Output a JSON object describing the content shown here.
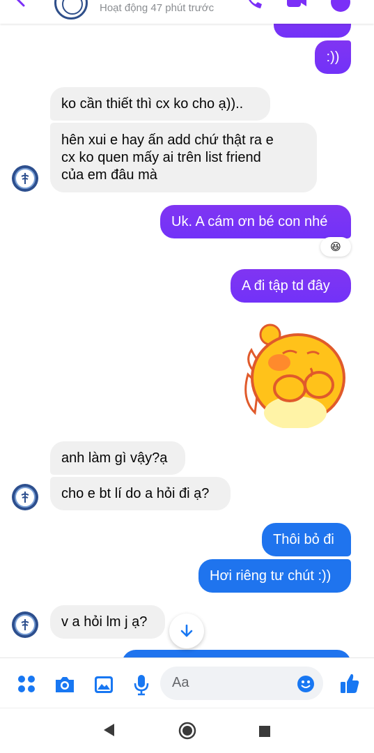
{
  "header": {
    "status": "Hoạt động 47 phút trước",
    "accent": "#7b2ff7"
  },
  "messages": [
    {
      "id": "m1",
      "side": "out",
      "text": ":))"
    },
    {
      "id": "m2",
      "side": "in",
      "text": "ko cần thiết thì cx ko cho ạ)).."
    },
    {
      "id": "m3",
      "side": "in",
      "lines": [
        "hên xui e hay ấn add chứ thật ra e",
        "cx ko quen mấy ai trên list friend",
        "của em đâu mà"
      ]
    },
    {
      "id": "m4",
      "side": "out",
      "text": "Uk. A cám ơn bé con nhé",
      "reaction": "😆"
    },
    {
      "id": "m5",
      "side": "out",
      "text": "A đi tập td đây"
    },
    {
      "id": "m6",
      "side": "out",
      "type": "sticker",
      "sticker": "shy-yellow-character-sticker"
    },
    {
      "id": "m7",
      "side": "in",
      "text": "anh làm gì vậy?ạ"
    },
    {
      "id": "m8",
      "side": "in",
      "text": "cho e bt lí do a hỏi đi ạ?"
    },
    {
      "id": "m9",
      "side": "out",
      "text": "Thôi bỏ đi"
    },
    {
      "id": "m10",
      "side": "out",
      "text": "Hơi riêng tư chút :))"
    },
    {
      "id": "m11",
      "side": "in",
      "text": "v a hỏi lm j ạ?"
    }
  ],
  "composer": {
    "placeholder": "Aa",
    "icons": [
      "grid-icon",
      "camera-icon",
      "gallery-icon",
      "microphone-icon",
      "emoji-icon",
      "like-icon"
    ],
    "accent": "#1877f2"
  },
  "navbar": {
    "icons": [
      "back-triangle-icon",
      "home-circle-icon",
      "recents-square-icon"
    ]
  }
}
